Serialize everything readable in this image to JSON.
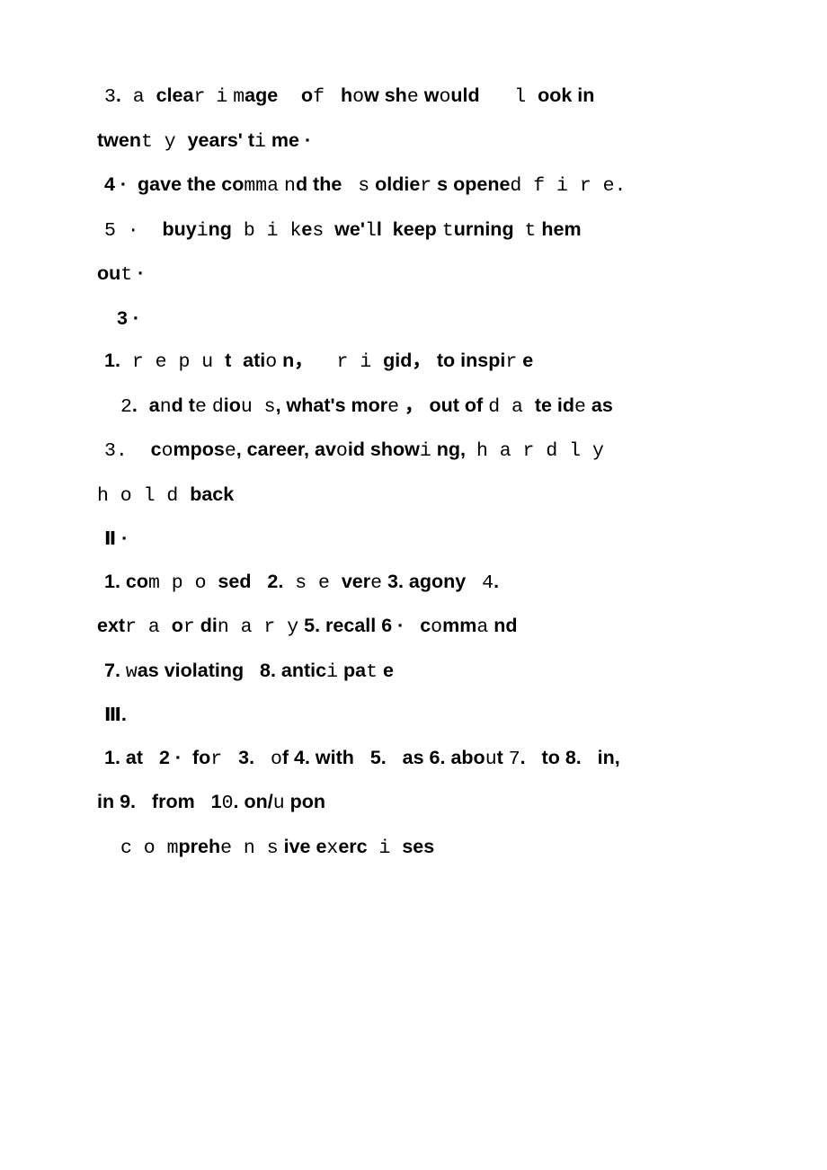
{
  "document": {
    "page_background": "#ffffff",
    "text_color": "#000000",
    "type": "scanned-answer-key",
    "lines": [
      {
        "id": "l1",
        "text": "3. a clear image of how she would look in",
        "indent": "indent1"
      },
      {
        "id": "l2",
        "text": "twenty years' time·",
        "indent": ""
      },
      {
        "id": "l3",
        "text": "4· gave the command the soldiers opened fire.",
        "indent": "indent1"
      },
      {
        "id": "l4",
        "text": "5· buying bikes we'll keep turning them",
        "indent": "indent1"
      },
      {
        "id": "l5",
        "text": "out·",
        "indent": ""
      },
      {
        "id": "l6",
        "text": "3·",
        "indent": "indent3"
      },
      {
        "id": "l7",
        "text": "1. reputation，rigid，to inspire",
        "indent": "indent1"
      },
      {
        "id": "l8",
        "text": "2. and tedious, what's more， out of date ideas",
        "indent": "indent2"
      },
      {
        "id": "l9",
        "text": "3. compose, career, avoid showing,  hardly",
        "indent": "indent1"
      },
      {
        "id": "l10",
        "text": "hold back",
        "indent": ""
      },
      {
        "id": "l11",
        "text": "Ⅱ·",
        "indent": "indent1"
      },
      {
        "id": "l12",
        "text": "1. composed  2. severe 3. agony  4.",
        "indent": "indent1"
      },
      {
        "id": "l13",
        "text": "extraordinary 5. recall 6·  command",
        "indent": ""
      },
      {
        "id": "l14",
        "text": "7. was violating  8. anticipate",
        "indent": "indent1"
      },
      {
        "id": "l15",
        "text": "Ⅲ.",
        "indent": "indent1"
      },
      {
        "id": "l16",
        "text": "1. at  2· for  3.  of 4. with  5.  as 6. about 7.  to 8.  in,",
        "indent": "indent1"
      },
      {
        "id": "l17",
        "text": "in 9.  from  10. on/upon",
        "indent": ""
      },
      {
        "id": "l18",
        "text": "comprehensive exercises",
        "indent": "indent2"
      }
    ],
    "sections": {
      "section_3_label": "3·",
      "section_2_label": "Ⅱ·",
      "section_3r_label": "Ⅲ.",
      "footer_label": "comprehensive exercises"
    },
    "answers": {
      "group_one": [
        "3. a clear image of how she would look in twenty years' time·",
        "4· gave the command the soldiers opened fire.",
        "5· buying bikes we'll keep turning them out·"
      ],
      "group_three": [
        "1. reputation，rigid，to inspire",
        "2. and tedious, what's more， out of date ideas",
        "3. compose, career, avoid showing, hardly hold back"
      ],
      "group_II": [
        "1. composed",
        "2. severe",
        "3. agony",
        "4. extraordinary",
        "5. recall",
        "6· command",
        "7. was violating",
        "8. anticipate"
      ],
      "group_III": [
        "1. at",
        "2· for",
        "3. of",
        "4. with",
        "5. as",
        "6. about",
        "7. to",
        "8. in, in",
        "9. from",
        "10. on/upon"
      ]
    }
  }
}
